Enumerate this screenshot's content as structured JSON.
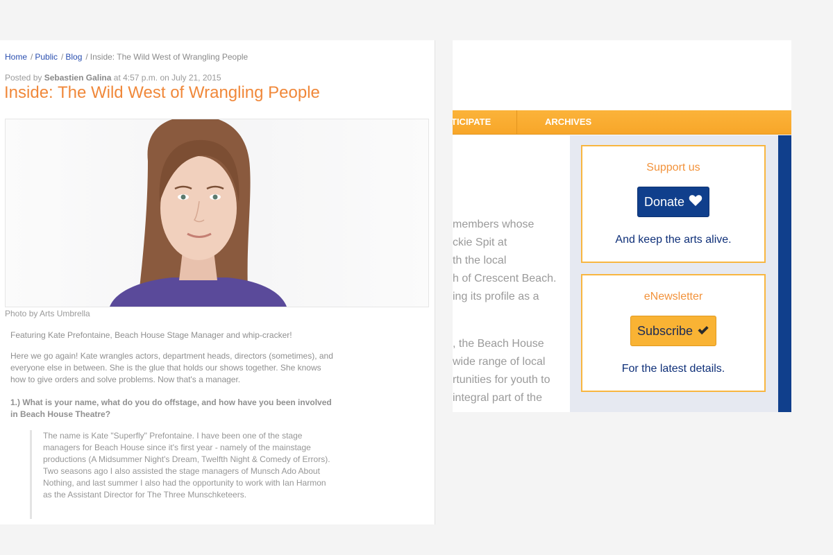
{
  "breadcrumb": {
    "items": [
      "Home",
      "Public",
      "Blog"
    ],
    "current": "Inside: The Wild West of Wrangling People",
    "separator": "/"
  },
  "post": {
    "posted_by_prefix": "Posted by",
    "author": "Sebastien Galina",
    "time_text": "at 4:57 p.m. on July 21, 2015",
    "title": "Inside: The Wild West of Wrangling People",
    "photo_caption": "Photo by Arts Umbrella",
    "intro": "Featuring Kate Prefontaine, Beach House Stage Manager and whip-cracker!",
    "paragraph": "Here we go again! Kate wrangles actors, department heads, directors (sometimes), and everyone else in between. She is the glue that holds our shows together. She knows how to give orders and solve problems. Now that's a manager.",
    "question": "1.) What is your name, what do you do offstage, and how have you been involved in Beach House Theatre?",
    "answer": "The name is Kate \"Superfly\" Prefontaine. I have been one of the stage managers for Beach House since it's first year - namely of the mainstage productions (A Midsummer Night's Dream, Twelfth Night & Comedy of Errors). Two seasons ago I also assisted the stage managers of Munsch Ado About Nothing, and last summer I also had the opportunity to work with Ian Harmon as the Assistant Director for The Three Munschketeers."
  },
  "site": {
    "nav": {
      "participate": "TICIPATE",
      "archives": "ARCHIVES"
    },
    "content_block1": [
      "members whose",
      "ckie Spit at",
      "th the local",
      "h of Crescent Beach.",
      "ing its profile as a"
    ],
    "content_block2": [
      ", the Beach House",
      "wide range of local",
      "rtunities for youth to",
      "integral part of the"
    ],
    "support": {
      "title": "Support us",
      "button": "Donate",
      "note": "And keep the arts alive."
    },
    "newsletter": {
      "title": "eNewsletter",
      "button": "Subscribe",
      "note": "For the latest details."
    }
  },
  "colors": {
    "orange": "#f0883a",
    "nav_orange": "#f8a629",
    "navy": "#103f8c",
    "gold": "#f9b334",
    "link_blue": "#2a4fb0"
  },
  "icons": {
    "donate": "heart-icon",
    "subscribe": "check-icon"
  }
}
